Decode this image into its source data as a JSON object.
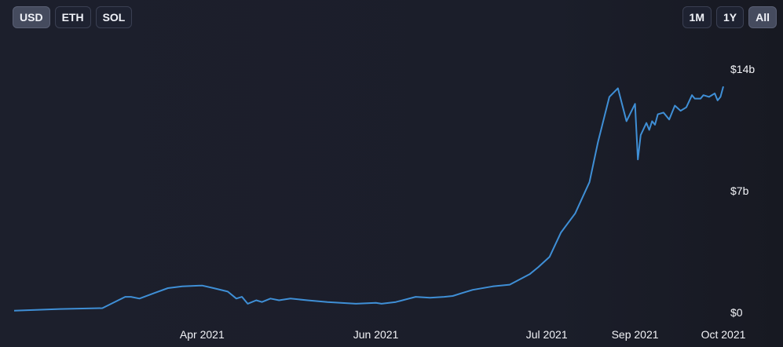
{
  "currency_buttons": [
    {
      "label": "USD",
      "active": true
    },
    {
      "label": "ETH",
      "active": false
    },
    {
      "label": "SOL",
      "active": false
    }
  ],
  "range_buttons": [
    {
      "label": "1M",
      "active": false
    },
    {
      "label": "1Y",
      "active": false
    },
    {
      "label": "All",
      "active": true
    }
  ],
  "colors": {
    "line": "#3f8fd6",
    "background": "#1c1f2c",
    "text": "#f2f3f7"
  },
  "chart_data": {
    "type": "line",
    "title": "",
    "xlabel": "",
    "ylabel": "",
    "ylim": [
      0,
      14
    ],
    "y_unit": "$ billions",
    "y_ticks": [
      {
        "value": 0,
        "label": "$0"
      },
      {
        "value": 7,
        "label": "$7b"
      },
      {
        "value": 14,
        "label": "$14b"
      }
    ],
    "x_ticks": [
      {
        "date": "2021-04-01",
        "label": "Apr 2021"
      },
      {
        "date": "2021-06-01",
        "label": "Jun 2021"
      },
      {
        "date": "2021-07-31",
        "label": "Jul 2021"
      },
      {
        "date": "2021-08-31",
        "label": "Sep 2021"
      },
      {
        "date": "2021-10-01",
        "label": "Oct 2021"
      }
    ],
    "x_range": [
      "2021-01-25",
      "2021-10-01"
    ],
    "grid": false,
    "series": [
      {
        "name": "",
        "x": [
          "2021-01-25",
          "2021-02-10",
          "2021-02-25",
          "2021-03-05",
          "2021-03-07",
          "2021-03-10",
          "2021-03-15",
          "2021-03-20",
          "2021-03-25",
          "2021-04-01",
          "2021-04-05",
          "2021-04-10",
          "2021-04-13",
          "2021-04-15",
          "2021-04-17",
          "2021-04-20",
          "2021-04-22",
          "2021-04-25",
          "2021-04-28",
          "2021-05-02",
          "2021-05-08",
          "2021-05-15",
          "2021-05-25",
          "2021-06-01",
          "2021-06-03",
          "2021-06-08",
          "2021-06-15",
          "2021-06-20",
          "2021-06-25",
          "2021-06-28",
          "2021-07-01",
          "2021-07-05",
          "2021-07-12",
          "2021-07-18",
          "2021-07-25",
          "2021-07-28",
          "2021-08-01",
          "2021-08-05",
          "2021-08-10",
          "2021-08-15",
          "2021-08-18",
          "2021-08-22",
          "2021-08-25",
          "2021-08-28",
          "2021-08-31",
          "2021-09-01",
          "2021-09-02",
          "2021-09-04",
          "2021-09-05",
          "2021-09-06",
          "2021-09-07",
          "2021-09-08",
          "2021-09-10",
          "2021-09-12",
          "2021-09-14",
          "2021-09-16",
          "2021-09-18",
          "2021-09-20",
          "2021-09-21",
          "2021-09-23",
          "2021-09-24",
          "2021-09-26",
          "2021-09-28",
          "2021-09-29",
          "2021-09-30",
          "2021-10-01"
        ],
        "y": [
          0.1,
          0.2,
          0.25,
          0.9,
          0.9,
          0.8,
          1.1,
          1.4,
          1.5,
          1.55,
          1.4,
          1.2,
          0.8,
          0.9,
          0.5,
          0.7,
          0.6,
          0.8,
          0.7,
          0.8,
          0.7,
          0.6,
          0.5,
          0.55,
          0.5,
          0.6,
          0.9,
          0.85,
          0.9,
          0.95,
          1.1,
          1.3,
          1.5,
          1.6,
          2.2,
          2.6,
          3.2,
          4.6,
          5.7,
          7.5,
          9.8,
          12.4,
          12.9,
          11.0,
          12.0,
          8.8,
          10.2,
          10.9,
          10.5,
          11.0,
          10.8,
          11.4,
          11.5,
          11.1,
          11.9,
          11.6,
          11.8,
          12.5,
          12.3,
          12.3,
          12.5,
          12.4,
          12.6,
          12.2,
          12.4,
          13.0
        ]
      }
    ]
  }
}
